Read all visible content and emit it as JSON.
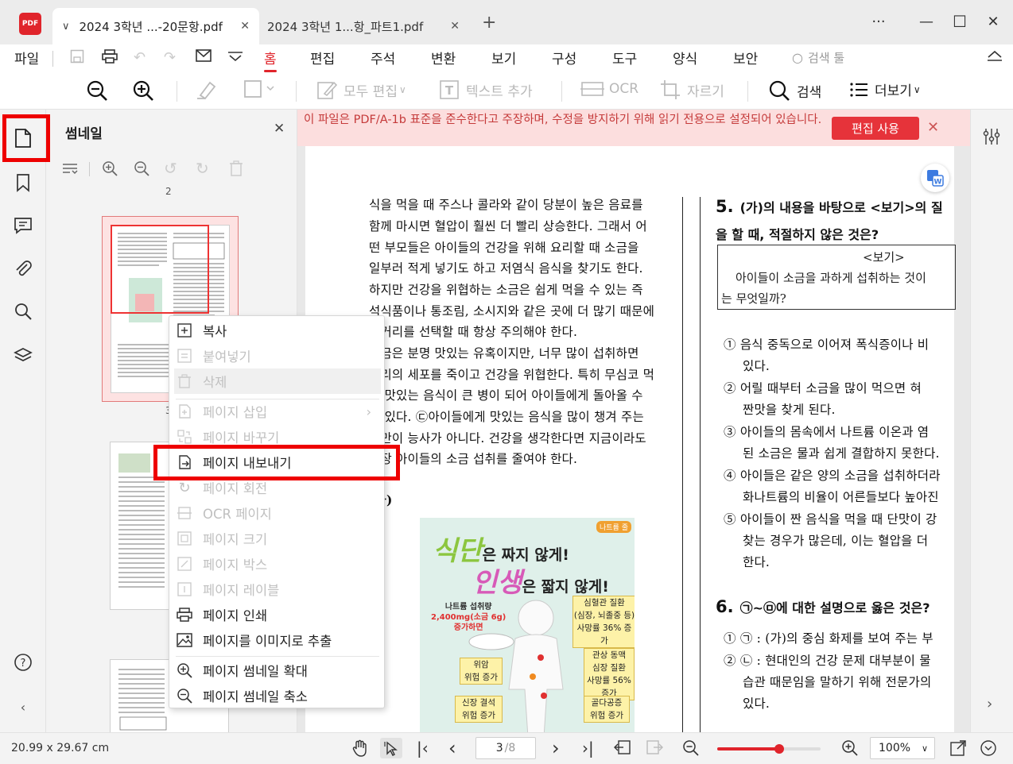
{
  "tabs": [
    {
      "label": "2024  3학년  ...-20문항.pdf",
      "active": true
    },
    {
      "label": "2024  3학년  1...항_파트1.pdf",
      "active": false
    }
  ],
  "window_controls": {
    "more": "···",
    "minimize": "—",
    "maximize": "☐",
    "close": "✕"
  },
  "menu": {
    "file": "파일",
    "items": [
      "홈",
      "편집",
      "주석",
      "변환",
      "보기",
      "구성",
      "도구",
      "양식",
      "보안"
    ],
    "active": "홈",
    "search_tool": "검색 툴"
  },
  "toolbar": {
    "edit_all": "모두 편집",
    "add_text": "텍스트 추가",
    "ocr": "OCR",
    "crop": "자르기",
    "search": "검색",
    "more": "더보기"
  },
  "thumbnail_panel": {
    "title": "썸네일",
    "page_labels": [
      "2",
      "3"
    ]
  },
  "banner": {
    "text": "이 파일은 PDF/A-1b 표준을 준수한다고 주장하며, 수정을 방지하기 위해 읽기 전용으로 설정되어 있습니다.",
    "button": "편집 사용"
  },
  "document": {
    "col1_lines": [
      "식을 먹을 때 주스나 콜라와 같이 당분이 높은 음료를",
      "함께 마시면 혈압이 훨씬 더 빨리 상승한다. 그래서 어",
      "떤 부모들은 아이들의 건강을 위해 요리할 때 소금을",
      "일부러 적게 넣기도 하고 저염식 음식을 찾기도 한다.",
      "하지만 건강을 위협하는 소금은 쉽게 먹을 수 있는 즉",
      "석식품이나 통조림, 소시지와 같은 곳에 더 많기 때문에",
      "먹거리를 선택할 때 항상 주의해야 한다.",
      "소금은 분명 맛있는 유혹이지만, 너무 많이 섭취하면",
      "우리의 세포를 죽이고 건강을 위협한다. 특히 무심코 먹",
      "은 맛있는 음식이 큰 병이 되어 아이들에게 돌아올 수",
      "도 있다. ㉢아이들에게 맛있는 음식을 많이 챙겨 주는",
      "것만이 능사가 아니다. 건강을 생각한다면 지금이라도",
      "당장 아이들의 소금 섭취를 줄여야 한다."
    ],
    "section_label": "(나)",
    "poster": {
      "line1_big": "식단",
      "line1_rest": "은 짜지 않게!",
      "line2_big": "인생",
      "line2_rest": "은 짧지 않게!",
      "corner_tag": "나트륨 줄",
      "intake": [
        "나트륨 섭취량",
        "2,400mg(소금 6g)",
        "증가하면"
      ],
      "labels": [
        {
          "text": [
            "심혈관 질환",
            "(심장, 뇌졸중 등)",
            "사망률 36% 증가"
          ]
        },
        {
          "text": [
            "관상 동맥",
            "심장 질환",
            "사망률 56% 증가"
          ]
        },
        {
          "text": [
            "위암",
            "위험 증가"
          ]
        },
        {
          "text": [
            "신장 결석",
            "위험 증가"
          ]
        },
        {
          "text": [
            "골다공증",
            "위험 증가"
          ]
        }
      ]
    },
    "q5": {
      "number": "5.",
      "title_line1": "(가)의 내용을 바탕으로 <보기>의 질",
      "title_line2": "을 할 때, 적절하지 않은 것은?",
      "box_title": "<보기>",
      "box_line1": "아이들이 소금을 과하게 섭취하는 것이",
      "box_line2": "는 무엇일까?",
      "options": [
        [
          "① 음식 중독으로 이어져 폭식증이나 비",
          "있다."
        ],
        [
          "② 어릴 때부터 소금을 많이 먹으면 혀",
          "짠맛을 찾게 된다."
        ],
        [
          "③ 아이들의 몸속에서 나트륨 이온과 염",
          "된 소금은 물과 쉽게 결합하지 못한다."
        ],
        [
          "④ 아이들은 같은 양의 소금을 섭취하더라",
          "화나트륨의 비율이 어른들보다 높아진"
        ],
        [
          "⑤ 아이들이 짠 음식을 먹을 때 단맛이 강",
          "찾는 경우가 많은데, 이는 혈압을 더",
          "한다."
        ]
      ]
    },
    "q6": {
      "number": "6.",
      "title": "㉠~㉤에 대한 설명으로 옳은 것은?",
      "options": [
        [
          "① ㉠ : (가)의 중심 화제를 보여 주는 부"
        ],
        [
          "② ㉡ : 현대인의 건강 문제 대부분이 물",
          "습관 때문임을 말하기 위해 전문가의",
          "있다."
        ]
      ]
    }
  },
  "context_menu": {
    "items": [
      {
        "label": "복사",
        "icon": "copy-icon",
        "disabled": false
      },
      {
        "label": "붙여넣기",
        "icon": "paste-icon",
        "disabled": true
      },
      {
        "label": "삭제",
        "icon": "trash-icon",
        "disabled": true
      },
      {
        "label": "페이지 삽입",
        "icon": "insert-page-icon",
        "disabled": true,
        "submenu": true
      },
      {
        "label": "페이지 바꾸기",
        "icon": "replace-page-icon",
        "disabled": true
      },
      {
        "label": "페이지 내보내기",
        "icon": "export-page-icon",
        "disabled": false,
        "highlighted": true
      },
      {
        "label": "페이지 회전",
        "icon": "rotate-icon",
        "disabled": true
      },
      {
        "label": "OCR 페이지",
        "icon": "ocr-icon",
        "disabled": true
      },
      {
        "label": "페이지 크기",
        "icon": "page-size-icon",
        "disabled": true
      },
      {
        "label": "페이지 박스",
        "icon": "page-box-icon",
        "disabled": true
      },
      {
        "label": "페이지 레이블",
        "icon": "page-label-icon",
        "disabled": true
      },
      {
        "label": "페이지 인쇄",
        "icon": "print-icon",
        "disabled": false
      },
      {
        "label": "페이지를 이미지로 추출",
        "icon": "image-icon",
        "disabled": false
      },
      {
        "label": "페이지 썸네일 확대",
        "icon": "zoom-in-icon",
        "disabled": false
      },
      {
        "label": "페이지 썸네일 축소",
        "icon": "zoom-out-icon",
        "disabled": false
      }
    ]
  },
  "statusbar": {
    "page_size": "20.99 x 29.67 cm",
    "current_page": "3",
    "total_pages": "/8",
    "zoom": "100%",
    "zoom_slider_fraction": 0.6
  },
  "colors": {
    "accent": "#e0242b",
    "highlight_red": "#ee0000",
    "banner_bg": "#fcdede",
    "banner_text": "#c53a3a"
  }
}
